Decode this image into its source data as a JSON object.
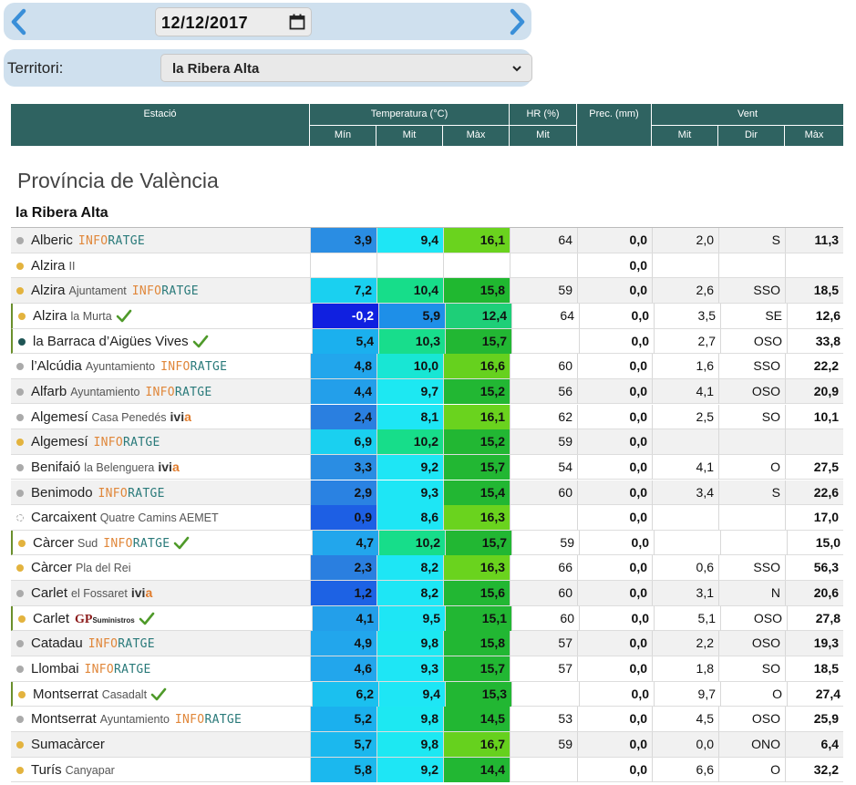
{
  "date_bar": {
    "date": "12/12/2017",
    "prev_icon": "chevron-left-icon",
    "next_icon": "chevron-right-icon",
    "calendar_icon": "calendar-icon"
  },
  "territory": {
    "label": "Territori:",
    "selected": "la Ribera Alta"
  },
  "header": {
    "estacio": "Estació",
    "temperatura": "Temperatura (°C)",
    "hr": "HR (%)",
    "prec": "Prec. (mm)",
    "vent": "Vent",
    "min": "Mín",
    "mit": "Mit",
    "max": "Màx",
    "hr_mit": "Mit",
    "vent_mit": "Mit",
    "vent_dir": "Dir",
    "vent_max": "Màx"
  },
  "province": "Província de València",
  "comarca": "la Ribera Alta",
  "colors": {
    "header_bg": "#2f6361",
    "bar_bg": "#cfe0ee",
    "accent_blue": "#3a8fd8"
  },
  "rows": [
    {
      "name": "Alberic",
      "sub": "",
      "brand": "INFORATGE",
      "dot": "gray",
      "check": false,
      "tmin": "3,9",
      "tmit": "9,4",
      "tmax": "16,1",
      "hr": "64",
      "prec": "0,0",
      "vmit": "2,0",
      "vdir": "S",
      "vmax": "11,3",
      "cmin": "#2a8de3",
      "cmit": "#1ee6f5",
      "cmax": "#6ad31e"
    },
    {
      "name": "Alzira",
      "sub": "II",
      "brand": "",
      "dot": "yellow",
      "check": false,
      "tmin": "",
      "tmit": "",
      "tmax": "",
      "hr": "",
      "prec": "0,0",
      "vmit": "",
      "vdir": "",
      "vmax": "",
      "cmin": "",
      "cmit": "",
      "cmax": ""
    },
    {
      "name": "Alzira",
      "sub": "Ajuntament",
      "brand": "INFORATGE",
      "dot": "yellow",
      "check": false,
      "tmin": "7,2",
      "tmit": "10,4",
      "tmax": "15,8",
      "hr": "59",
      "prec": "0,0",
      "vmit": "2,6",
      "vdir": "SSO",
      "vmax": "18,5",
      "cmin": "#1ad0f0",
      "cmit": "#17dd8a",
      "cmax": "#20b830"
    },
    {
      "name": "Alzira",
      "sub": "la Murta",
      "brand": "",
      "dot": "yellow",
      "check": true,
      "tmin": "-0,2",
      "tmit": "5,9",
      "tmax": "12,4",
      "hr": "64",
      "prec": "0,0",
      "vmit": "3,5",
      "vdir": "SE",
      "vmax": "12,6",
      "cmin": "#1020e0",
      "cmit": "#1e8fe8",
      "cmax": "#1ecf78"
    },
    {
      "name": "la Barraca d’Aigües Vives",
      "sub": "",
      "brand": "",
      "dot": "teal",
      "check": true,
      "tmin": "5,4",
      "tmit": "10,3",
      "tmax": "15,7",
      "hr": "",
      "prec": "0,0",
      "vmit": "2,7",
      "vdir": "OSO",
      "vmax": "33,8",
      "cmin": "#1bb0ee",
      "cmit": "#18dd8c",
      "cmax": "#22b733"
    },
    {
      "name": "l’Alcúdia",
      "sub": "Ayuntamiento",
      "brand": "INFORATGE",
      "dot": "gray",
      "check": false,
      "tmin": "4,8",
      "tmit": "10,0",
      "tmax": "16,6",
      "hr": "60",
      "prec": "0,0",
      "vmit": "1,6",
      "vdir": "SSO",
      "vmax": "22,2",
      "cmin": "#22a6ec",
      "cmit": "#18e6d4",
      "cmax": "#66d11e"
    },
    {
      "name": "Alfarb",
      "sub": "Ayuntamiento",
      "brand": "INFORATGE",
      "dot": "gray",
      "check": false,
      "tmin": "4,4",
      "tmit": "9,7",
      "tmax": "15,2",
      "hr": "56",
      "prec": "0,0",
      "vmit": "4,1",
      "vdir": "OSO",
      "vmax": "20,9",
      "cmin": "#239fea",
      "cmit": "#1de8f2",
      "cmax": "#22b733"
    },
    {
      "name": "Algemesí",
      "sub": "Casa Penedés",
      "brand": "ivia",
      "dot": "gray",
      "check": false,
      "tmin": "2,4",
      "tmit": "8,1",
      "tmax": "16,1",
      "hr": "62",
      "prec": "0,0",
      "vmit": "2,5",
      "vdir": "SO",
      "vmax": "10,1",
      "cmin": "#2a7fe0",
      "cmit": "#1ee6f5",
      "cmax": "#6ad31e"
    },
    {
      "name": "Algemesí",
      "sub": "",
      "brand": "INFORATGE",
      "dot": "yellow",
      "check": false,
      "tmin": "6,9",
      "tmit": "10,2",
      "tmax": "15,2",
      "hr": "59",
      "prec": "0,0",
      "vmit": "",
      "vdir": "",
      "vmax": "",
      "cmin": "#1ad0f0",
      "cmit": "#17dd8a",
      "cmax": "#22b733"
    },
    {
      "name": "Benifaió",
      "sub": "la Belenguera",
      "brand": "ivia",
      "dot": "gray",
      "check": false,
      "tmin": "3,3",
      "tmit": "9,2",
      "tmax": "15,7",
      "hr": "54",
      "prec": "0,0",
      "vmit": "4,1",
      "vdir": "O",
      "vmax": "27,5",
      "cmin": "#2a8de3",
      "cmit": "#1ee6f5",
      "cmax": "#22b733"
    },
    {
      "name": "Benimodo",
      "sub": "",
      "brand": "INFORATGE",
      "dot": "gray",
      "check": false,
      "tmin": "2,9",
      "tmit": "9,3",
      "tmax": "15,4",
      "hr": "60",
      "prec": "0,0",
      "vmit": "3,4",
      "vdir": "S",
      "vmax": "22,6",
      "cmin": "#2a82e2",
      "cmit": "#1ee6f5",
      "cmax": "#22b733"
    },
    {
      "name": "Carcaixent",
      "sub": "Quatre Camins AEMET",
      "brand": "",
      "dot": "dashed",
      "check": false,
      "tmin": "0,9",
      "tmit": "8,6",
      "tmax": "16,3",
      "hr": "",
      "prec": "0,0",
      "vmit": "",
      "vdir": "",
      "vmax": "17,0",
      "cmin": "#1d5fe4",
      "cmit": "#1ee6f5",
      "cmax": "#6ad31e"
    },
    {
      "name": "Càrcer",
      "sub": "Sud",
      "brand": "INFORATGE",
      "dot": "yellow",
      "check": true,
      "tmin": "4,7",
      "tmit": "10,2",
      "tmax": "15,7",
      "hr": "59",
      "prec": "0,0",
      "vmit": "",
      "vdir": "",
      "vmax": "15,0",
      "cmin": "#22a6ec",
      "cmit": "#17dd8a",
      "cmax": "#22b733"
    },
    {
      "name": "Càrcer",
      "sub": "Pla del Rei",
      "brand": "",
      "dot": "yellow",
      "check": false,
      "tmin": "2,3",
      "tmit": "8,2",
      "tmax": "16,3",
      "hr": "66",
      "prec": "0,0",
      "vmit": "0,6",
      "vdir": "SSO",
      "vmax": "56,3",
      "cmin": "#2a7fe0",
      "cmit": "#1ee6f5",
      "cmax": "#6ad31e"
    },
    {
      "name": "Carlet",
      "sub": "el Fossaret",
      "brand": "ivia",
      "dot": "gray",
      "check": false,
      "tmin": "1,2",
      "tmit": "8,2",
      "tmax": "15,6",
      "hr": "60",
      "prec": "0,0",
      "vmit": "3,1",
      "vdir": "N",
      "vmax": "20,6",
      "cmin": "#1d62e4",
      "cmit": "#1ee6f5",
      "cmax": "#22b733"
    },
    {
      "name": "Carlet",
      "sub": "",
      "brand": "GP",
      "dot": "yellow",
      "check": true,
      "tmin": "4,1",
      "tmit": "9,5",
      "tmax": "15,1",
      "hr": "60",
      "prec": "0,0",
      "vmit": "5,1",
      "vdir": "OSO",
      "vmax": "27,8",
      "cmin": "#239fea",
      "cmit": "#1ee6f5",
      "cmax": "#22b733"
    },
    {
      "name": "Catadau",
      "sub": "",
      "brand": "INFORATGE",
      "dot": "gray",
      "check": false,
      "tmin": "4,9",
      "tmit": "9,8",
      "tmax": "15,8",
      "hr": "57",
      "prec": "0,0",
      "vmit": "2,2",
      "vdir": "OSO",
      "vmax": "19,3",
      "cmin": "#22a6ec",
      "cmit": "#1de8f2",
      "cmax": "#22b733"
    },
    {
      "name": "Llombai",
      "sub": "",
      "brand": "INFORATGE",
      "dot": "gray",
      "check": false,
      "tmin": "4,6",
      "tmit": "9,3",
      "tmax": "15,7",
      "hr": "57",
      "prec": "0,0",
      "vmit": "1,8",
      "vdir": "SO",
      "vmax": "18,5",
      "cmin": "#22a6ec",
      "cmit": "#1ee6f5",
      "cmax": "#22b733"
    },
    {
      "name": "Montserrat",
      "sub": "Casadalt",
      "brand": "",
      "dot": "yellow",
      "check": true,
      "tmin": "6,2",
      "tmit": "9,4",
      "tmax": "15,3",
      "hr": "",
      "prec": "0,0",
      "vmit": "9,7",
      "vdir": "O",
      "vmax": "27,4",
      "cmin": "#1bc0ef",
      "cmit": "#1ee6f5",
      "cmax": "#22b733"
    },
    {
      "name": "Montserrat",
      "sub": "Ayuntamiento",
      "brand": "INFORATGE",
      "dot": "gray",
      "check": false,
      "tmin": "5,2",
      "tmit": "9,8",
      "tmax": "14,5",
      "hr": "53",
      "prec": "0,0",
      "vmit": "4,5",
      "vdir": "OSO",
      "vmax": "25,9",
      "cmin": "#1bb0ee",
      "cmit": "#1de8f2",
      "cmax": "#22b733"
    },
    {
      "name": "Sumacàrcer",
      "sub": "",
      "brand": "",
      "dot": "yellow",
      "check": false,
      "tmin": "5,7",
      "tmit": "9,8",
      "tmax": "16,7",
      "hr": "59",
      "prec": "0,0",
      "vmit": "0,0",
      "vdir": "ONO",
      "vmax": "6,4",
      "cmin": "#1bb8ee",
      "cmit": "#1de8f2",
      "cmax": "#66d11e"
    },
    {
      "name": "Turís",
      "sub": "Canyapar",
      "brand": "",
      "dot": "yellow",
      "check": false,
      "tmin": "5,8",
      "tmit": "9,2",
      "tmax": "14,4",
      "hr": "",
      "prec": "0,0",
      "vmit": "6,6",
      "vdir": "O",
      "vmax": "32,2",
      "cmin": "#1bb8ee",
      "cmit": "#1ee6f5",
      "cmax": "#22b733"
    }
  ]
}
